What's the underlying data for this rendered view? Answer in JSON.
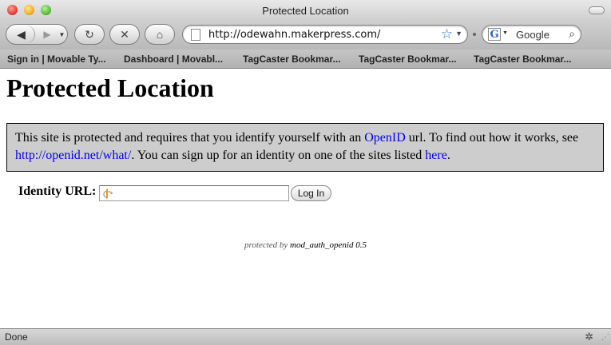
{
  "window": {
    "title": "Protected Location"
  },
  "toolbar": {
    "url": "http://odewahn.makerpress.com/",
    "search_engine": "Google"
  },
  "bookmarks": [
    "Sign in | Movable Ty...",
    "Dashboard | Movabl...",
    "TagCaster Bookmar...",
    "TagCaster Bookmar...",
    "TagCaster Bookmar..."
  ],
  "page": {
    "heading": "Protected Location",
    "notice": {
      "text1": "This site is protected and requires that you identify yourself with an ",
      "link_openid": "OpenID",
      "text2": " url. To find out how it works, see ",
      "link_what": "http://openid.net/what/",
      "text3": ". You can sign up for an identity on one of the sites listed ",
      "link_here": "here",
      "text4": "."
    },
    "identity_label": "Identity URL:",
    "identity_value": "",
    "login_button": "Log In",
    "footer_prefix": "protected by ",
    "footer_module": "mod_auth_openid 0.5"
  },
  "status": {
    "text": "Done"
  },
  "colors": {
    "link": "#0000ee",
    "notice_bg": "#cdcdcd"
  },
  "icons": {
    "back": "back-arrow-icon",
    "forward": "forward-arrow-icon",
    "reload": "reload-icon",
    "stop": "stop-icon",
    "home": "home-icon",
    "bookmark_star": "star-icon",
    "search": "magnifier-icon",
    "openid": "openid-logo-icon"
  }
}
